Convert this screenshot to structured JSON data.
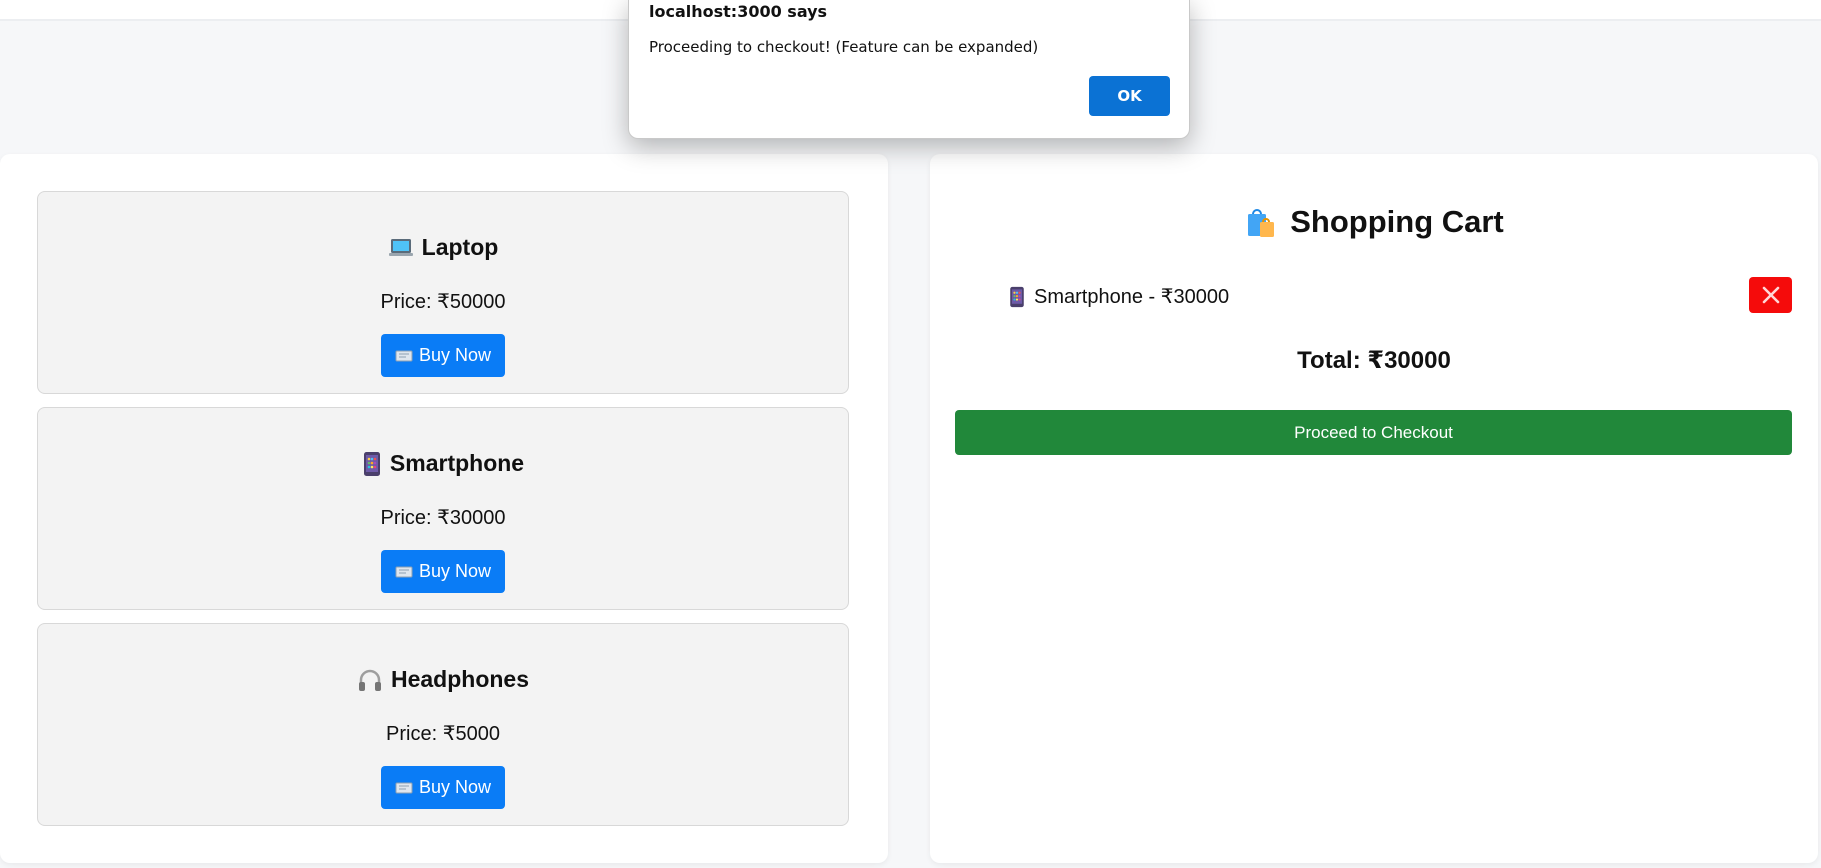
{
  "dialog": {
    "title": "localhost:3000 says",
    "message": "Proceeding to checkout! (Feature can be expanded)",
    "ok_label": "OK"
  },
  "products": [
    {
      "name": "Laptop",
      "icon": "laptop-icon",
      "price_text": "Price: ₹50000",
      "button_label": "Buy Now",
      "button_icon": "banknote-icon"
    },
    {
      "name": "Smartphone",
      "icon": "smartphone-icon",
      "price_text": "Price: ₹30000",
      "button_label": "Buy Now",
      "button_icon": "banknote-icon"
    },
    {
      "name": "Headphones",
      "icon": "headphones-icon",
      "price_text": "Price: ₹5000",
      "button_label": "Buy Now",
      "button_icon": "banknote-icon"
    }
  ],
  "cart": {
    "title": "Shopping Cart",
    "title_icon": "shopping-bags-icon",
    "items": [
      {
        "icon": "smartphone-icon",
        "text": "Smartphone - ₹30000",
        "remove_icon": "close-icon"
      }
    ],
    "total_text": "Total: ₹30000",
    "checkout_label": "Proceed to Checkout"
  },
  "colors": {
    "primary_button": "#0a7cf6",
    "checkout_button": "#21883a",
    "remove_button": "#f50b0b",
    "dialog_button": "#0b72d4"
  }
}
